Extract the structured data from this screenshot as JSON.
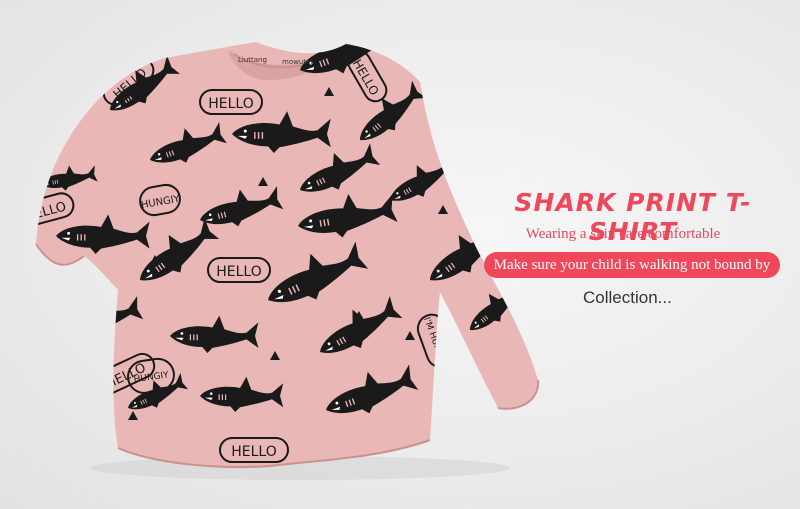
{
  "product": {
    "title": "SHARK PRINT T-SHIRT",
    "subtitle": "Wearing a skin care comfortable",
    "banner": "Make sure your child is walking not bound by",
    "collection": "Collection..."
  },
  "print_texts": {
    "hello": "HELLO",
    "hungry": "HUNGIY",
    "im_hungry": "I'M HUNGIY",
    "label_left": "Liuttang",
    "label_right": "mowuter"
  },
  "colors": {
    "shirt": "#e9b8b6",
    "shirt_shadow": "#d9a3a1",
    "print": "#1a1a1a",
    "accent": "#f0475a"
  }
}
